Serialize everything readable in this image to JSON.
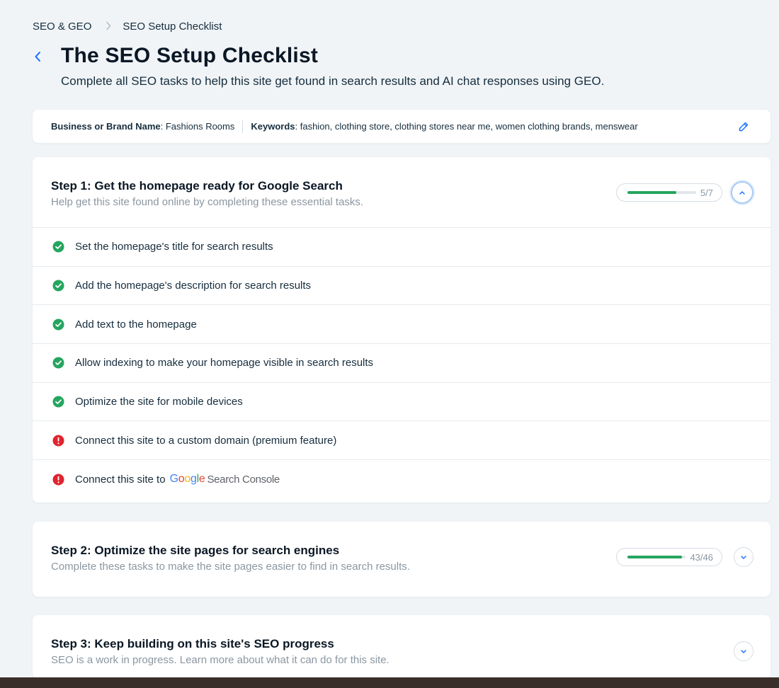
{
  "breadcrumb": {
    "parent": "SEO & GEO",
    "current": "SEO Setup Checklist"
  },
  "header": {
    "title": "The SEO Setup Checklist",
    "subtitle": "Complete all SEO tasks to help this site get found in search results and AI chat responses using GEO."
  },
  "info": {
    "brand_label": "Business or Brand Name",
    "brand_value": ": Fashions Rooms",
    "keywords_label": "Keywords",
    "keywords_value": ": fashion, clothing store, clothing stores near me, women clothing brands, menswear"
  },
  "steps": [
    {
      "title": "Step 1: Get the homepage ready for Google Search",
      "description": "Help get this site found online by completing these essential tasks.",
      "progress_text": "5/7",
      "progress_fraction": 0.714,
      "expanded": true,
      "tasks": [
        {
          "label": "Set the homepage's title for search results",
          "status": "done"
        },
        {
          "label": "Add the homepage's description for search results",
          "status": "done"
        },
        {
          "label": "Add text to the homepage",
          "status": "done"
        },
        {
          "label": "Allow indexing to make your homepage visible in search results",
          "status": "done"
        },
        {
          "label": "Optimize the site for mobile devices",
          "status": "done"
        },
        {
          "label": "Connect this site to a custom domain (premium feature)",
          "status": "error"
        },
        {
          "label": "Connect this site to",
          "status": "error",
          "brand_google": "Google",
          "brand_suffix": "Search Console"
        }
      ]
    },
    {
      "title": "Step 2: Optimize the site pages for search engines",
      "description": "Complete these tasks to make the site pages easier to find in search results.",
      "progress_text": "43/46",
      "progress_fraction": 0.935,
      "expanded": false
    },
    {
      "title": "Step 3: Keep building on this site's SEO progress",
      "description": "SEO is a work in progress. Learn more about what it can do for this site.",
      "expanded": false
    }
  ],
  "colors": {
    "success": "#25a55f",
    "error": "#e0242f",
    "accent": "#116dff",
    "google_blue": "#4285F4",
    "google_red": "#EA4335",
    "google_yellow": "#FBBC05",
    "google_green": "#34A853"
  },
  "icons": {
    "back": "chevron-left-icon",
    "edit": "pencil-icon",
    "done": "check-circle-icon",
    "error": "exclamation-circle-icon",
    "expand": "chevron-down-icon",
    "collapse": "chevron-up-icon"
  }
}
